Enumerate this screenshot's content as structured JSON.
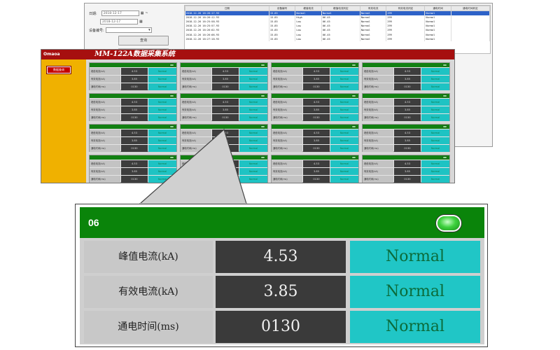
{
  "query": {
    "date_label": "日期:",
    "date_from": "2018-12-17",
    "date_to": "2018-12-17",
    "range_sep": "~",
    "device_label": "设备编号:",
    "query_button": "查询",
    "columns": [
      "日期",
      "设备编号",
      "峰值电流",
      "峰值电流判定",
      "有效电流",
      "有效电流判定",
      "通电时间",
      "通电时间判定"
    ],
    "rows": [
      [
        "2018-12-26 16:26:17.93",
        "15.85",
        "Normal",
        "Normal",
        "Normal",
        "299",
        "Normal",
        ""
      ],
      [
        "2018-12-26 16:26:12.93",
        "15.85",
        "High",
        "06.45",
        "Normal",
        "299",
        "Normal",
        ""
      ],
      [
        "2018-12-26 16:25:58.93",
        "15.85",
        "Low",
        "06.45",
        "Normal",
        "299",
        "Normal",
        ""
      ],
      [
        "2018-12-26 16:25:57.93",
        "15.85",
        "Low",
        "06.45",
        "Normal",
        "299",
        "Normal",
        ""
      ],
      [
        "2018-12-26 16:26:02.93",
        "15.85",
        "Low",
        "06.45",
        "Normal",
        "299",
        "Normal",
        ""
      ],
      [
        "2018-12-26 16:26:06.93",
        "15.85",
        "Low",
        "06.45",
        "Normal",
        "299",
        "Normal",
        ""
      ],
      [
        "2018-12-26 16:27:18.93",
        "15.85",
        "Low",
        "06.45",
        "Normal",
        "299",
        "Normal",
        ""
      ]
    ]
  },
  "app": {
    "logo": "Omaoa",
    "title": "MM-122A数据采集系统",
    "sidebar_button": "数据查询"
  },
  "mini_panel": {
    "labels": [
      "峰值电流(kA)",
      "有效电流(kA)",
      "通电时间(ms)"
    ],
    "values": [
      "4.53",
      "3.85",
      "0130"
    ],
    "status": "Normal"
  },
  "zoom": {
    "id": "06",
    "led_color": "#3ed13e",
    "rows": [
      {
        "label": "峰值电流(kA)",
        "value": "4.53",
        "status": "Normal"
      },
      {
        "label": "有效电流(kA)",
        "value": "3.85",
        "status": "Normal"
      },
      {
        "label": "通电时间(ms)",
        "value": "0130",
        "status": "Normal"
      }
    ]
  }
}
